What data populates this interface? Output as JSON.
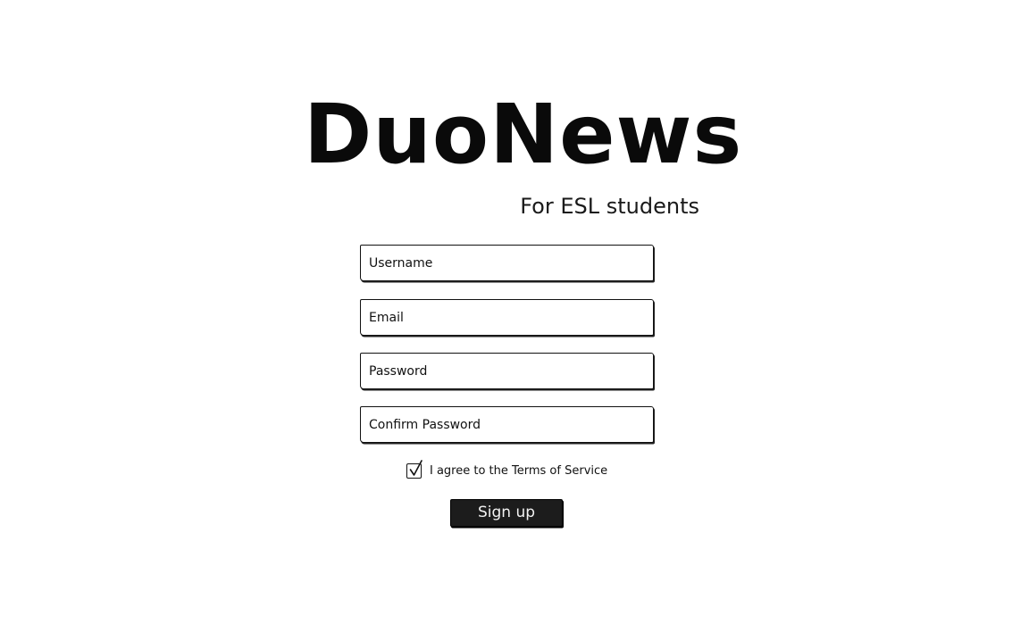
{
  "app": {
    "title": "DuoNews",
    "tagline": "For ESL students"
  },
  "form": {
    "username": {
      "placeholder": "Username",
      "value": ""
    },
    "email": {
      "placeholder": "Email",
      "value": ""
    },
    "password": {
      "placeholder": "Password",
      "value": ""
    },
    "confirm_password": {
      "placeholder": "Confirm Password",
      "value": ""
    },
    "terms": {
      "label": "I agree to the Terms of Service",
      "checked": true
    },
    "submit_label": "Sign up"
  },
  "icons": {
    "checkbox": "check-icon"
  }
}
